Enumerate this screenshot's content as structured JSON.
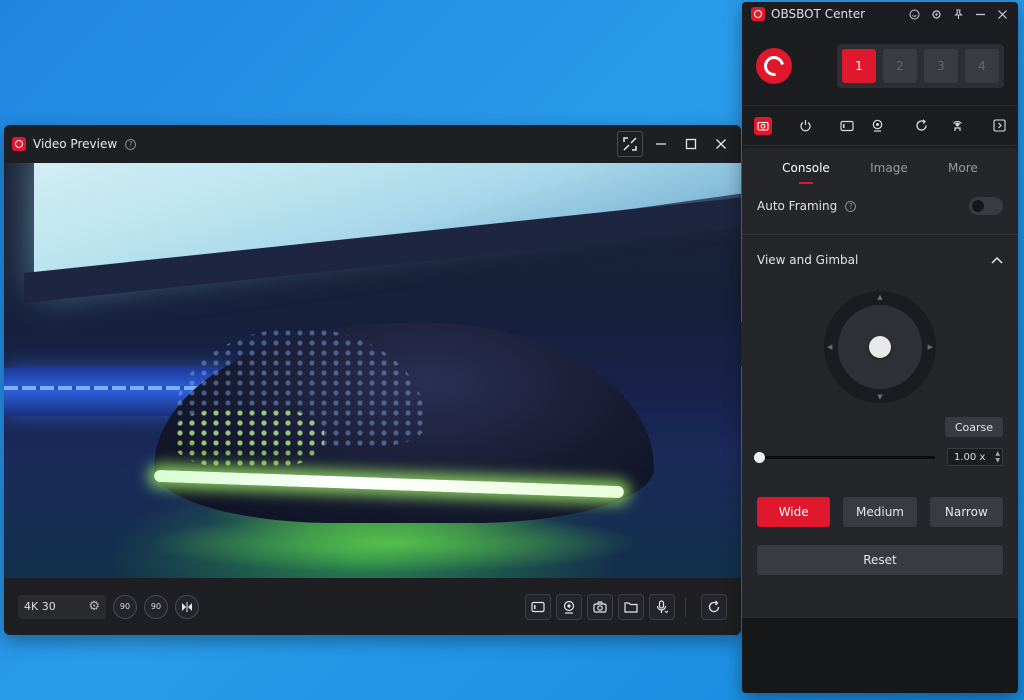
{
  "video_preview": {
    "title": "Video Preview",
    "resolution": "4K 30",
    "rotate_left_label": "90",
    "rotate_right_label": "90"
  },
  "obsbot": {
    "title": "OBSBOT Center",
    "slots": [
      "1",
      "2",
      "3",
      "4"
    ],
    "active_slot": "1",
    "tabs": [
      "Console",
      "Image",
      "More"
    ],
    "active_tab": "Console",
    "auto_framing_label": "Auto Framing",
    "view_gimbal_label": "View and Gimbal",
    "coarse_label": "Coarse",
    "zoom_value": "1.00 x",
    "fov_buttons": [
      "Wide",
      "Medium",
      "Narrow"
    ],
    "active_fov": "Wide",
    "reset_label": "Reset"
  },
  "colors": {
    "accent": "#e0182d",
    "panel_bg": "#1c1d20",
    "content_bg": "#252629",
    "desktop_bg": "#2a9bea"
  },
  "icons": {
    "app_logo": "obsbot-logo-icon",
    "help": "help-circle-icon",
    "fullscreen": "expand-icon",
    "minimize": "minimize-icon",
    "maximize": "maximize-icon",
    "close": "close-icon"
  }
}
